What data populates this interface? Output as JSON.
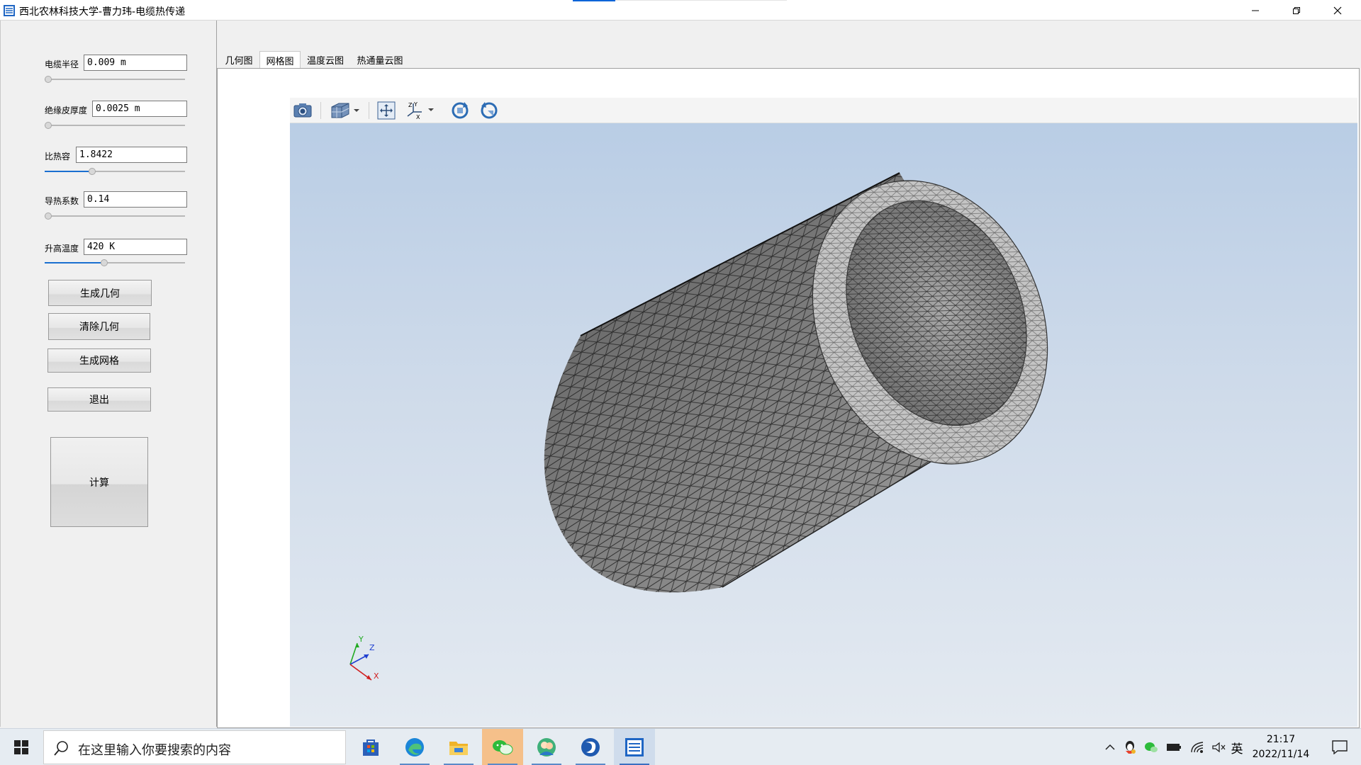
{
  "window": {
    "title": "西北农林科技大学-曹力玮-电缆热传递",
    "controls": [
      "minimize",
      "restore",
      "close"
    ]
  },
  "params": [
    {
      "label": "电缆半径",
      "value": "0.009 m",
      "slider": 0.0
    },
    {
      "label": "绝缘皮厚度",
      "value": "0.0025 m",
      "slider": 0.0
    },
    {
      "label": "比热容",
      "value": "1.8422",
      "slider": 0.33
    },
    {
      "label": "导热系数",
      "value": "0.14",
      "slider": 0.0
    },
    {
      "label": "升高温度",
      "value": "420 K",
      "slider": 0.42
    }
  ],
  "buttons": {
    "generate_geometry": "生成几何",
    "clear_geometry": "清除几何",
    "generate_mesh": "生成网格",
    "exit": "退出",
    "compute": "计算"
  },
  "tabs": [
    {
      "label": "几何图",
      "active": false
    },
    {
      "label": "网格图",
      "active": true
    },
    {
      "label": "温度云图",
      "active": false
    },
    {
      "label": "热通量云图",
      "active": false
    }
  ],
  "viewer": {
    "toolbar_icons": [
      "camera-icon",
      "view-cube-icon",
      "fit-all-icon",
      "axes-icon",
      "rotate-cw-icon",
      "rotate-ccw-icon"
    ],
    "axes": {
      "x": "X",
      "y": "Y",
      "z": "Z"
    },
    "colors": {
      "bg_top": "#b9cde5",
      "bg_bottom": "#e4eaf1",
      "mesh_face": "#8c8c8c",
      "mesh_edge": "#222222",
      "end_face": "#c4c4c4"
    }
  },
  "taskbar": {
    "search_placeholder": "在这里输入你要搜索的内容",
    "apps": [
      "start-icon",
      "store-icon",
      "edge-icon",
      "explorer-icon",
      "wechat-icon",
      "people-icon",
      "app-swirl-icon",
      "cable-app-icon"
    ],
    "ime": "英",
    "time": "21:17",
    "date": "2022/11/14"
  }
}
